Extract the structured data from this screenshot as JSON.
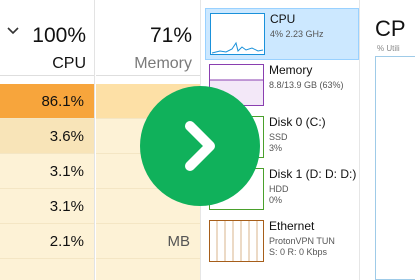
{
  "processes": {
    "cpu_column": {
      "percent": "100%",
      "label": "CPU"
    },
    "memory_column": {
      "percent": "71%",
      "label": "Memory"
    },
    "rows": [
      {
        "cpu": "86.1%",
        "memory": "",
        "cpu_color": "#f7a53c",
        "mem_color": "#fde0a6"
      },
      {
        "cpu": "3.6%",
        "memory": "",
        "cpu_color": "#f8e4b8",
        "mem_color": "#fdf2d6"
      },
      {
        "cpu": "3.1%",
        "memory": "",
        "cpu_color": "#fdf2d6",
        "mem_color": "#fdf2d6"
      },
      {
        "cpu": "3.1%",
        "memory": "",
        "cpu_color": "#fdf2d6",
        "mem_color": "#fdf2d6"
      },
      {
        "cpu": "2.1%",
        "memory": "MB",
        "cpu_color": "#fdf2d6",
        "mem_color": "#fdf2d6"
      },
      {
        "cpu": "",
        "memory": "",
        "cpu_color": "#fdf2d6",
        "mem_color": "#fdf2d6"
      }
    ]
  },
  "performance": {
    "items": [
      {
        "name": "CPU",
        "lines": [
          "4% 2.23 GHz"
        ],
        "color": "#1a91da"
      },
      {
        "name": "Memory",
        "lines": [
          "8.8/13.9 GB (63%)"
        ],
        "color": "#8a3fb0"
      },
      {
        "name": "Disk 0 (C:)",
        "lines": [
          "SSD",
          "3%"
        ],
        "color": "#4aa02c"
      },
      {
        "name": "Disk 1 (D: D: D:)",
        "lines": [
          "HDD",
          "0%"
        ],
        "color": "#4aa02c"
      },
      {
        "name": "Ethernet",
        "lines": [
          "ProtonVPN TUN",
          "S: 0 R: 0 Kbps"
        ],
        "color": "#a65e1a"
      }
    ]
  },
  "detail": {
    "title": "CP",
    "subtitle": "% Utili"
  },
  "overlay": {
    "icon": "chevron-right-icon",
    "color": "#10b15b"
  }
}
